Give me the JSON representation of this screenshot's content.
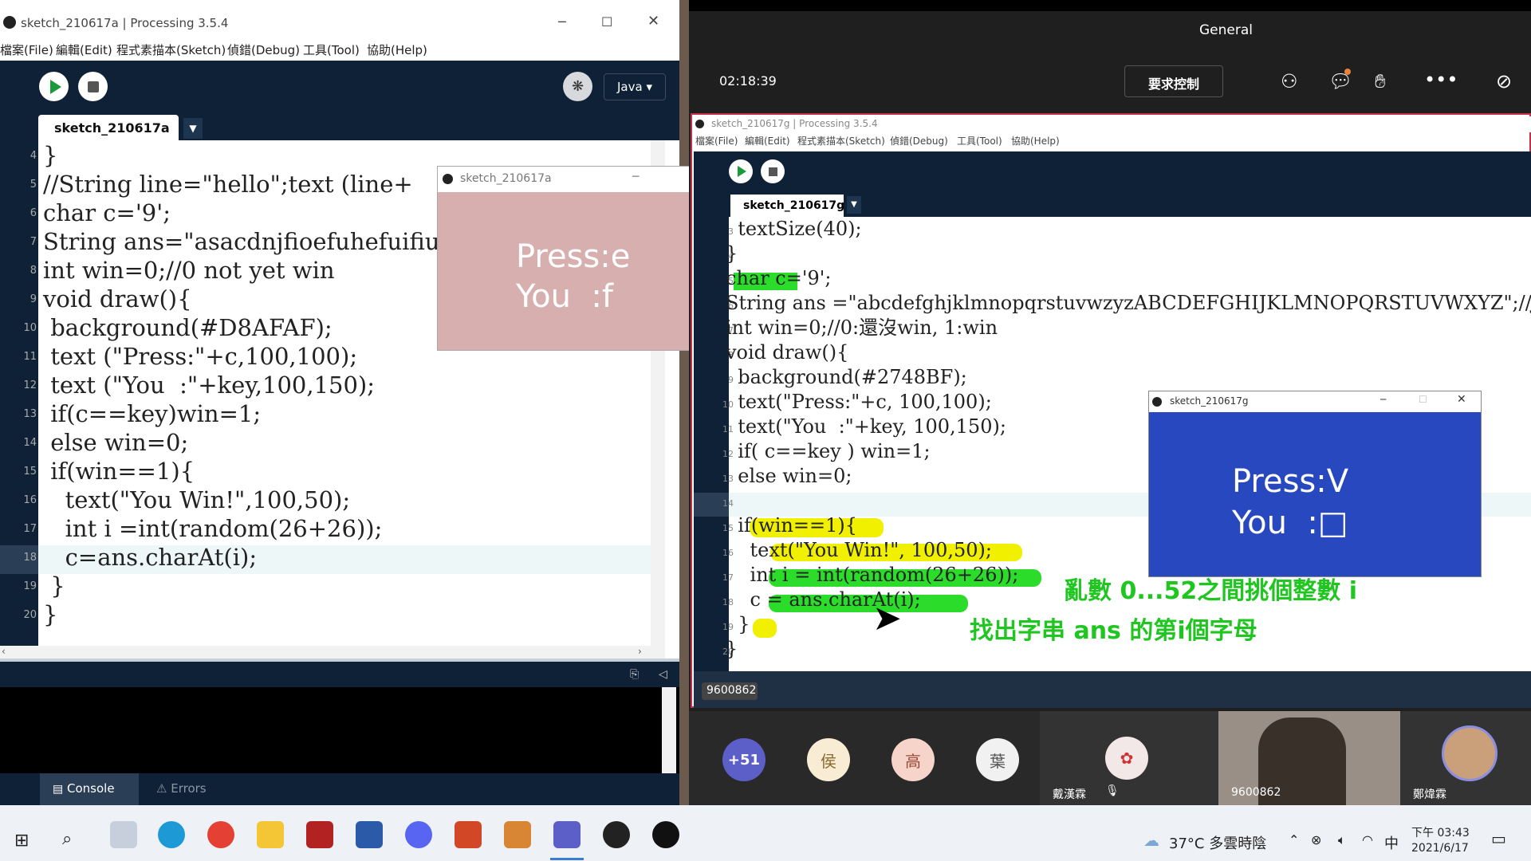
{
  "left": {
    "title": "sketch_210617a | Processing 3.5.4",
    "menu": [
      "檔案(File)",
      "編輯(Edit)",
      "程式素描本(Sketch)",
      "偵錯(Debug)",
      "工具(Tool)",
      "協助(Help)"
    ],
    "mode": "Java",
    "tab": "sketch_210617a",
    "lines": [
      {
        "n": "4",
        "t": "}"
      },
      {
        "n": "5",
        "t": "//String line=\"hello\";text (line+"
      },
      {
        "n": "6",
        "t": "char c='9';"
      },
      {
        "n": "7",
        "t": "String ans=\"asacdnjfioefuhefuifiu"
      },
      {
        "n": "8",
        "t": "int win=0;//0 not yet win"
      },
      {
        "n": "9",
        "t": "void draw(){"
      },
      {
        "n": "10",
        "t": " background(#D8AFAF);"
      },
      {
        "n": "11",
        "t": " text (\"Press:\"+c,100,100);"
      },
      {
        "n": "12",
        "t": " text (\"You  :\"+key,100,150);"
      },
      {
        "n": "13",
        "t": " if(c==key)win=1;"
      },
      {
        "n": "14",
        "t": " else win=0;"
      },
      {
        "n": "15",
        "t": " if(win==1){"
      },
      {
        "n": "16",
        "t": "   text(\"You Win!\",100,50);"
      },
      {
        "n": "17",
        "t": "   int i =int(random(26+26));"
      },
      {
        "n": "18",
        "t": "   c=ans.charAt(i);"
      },
      {
        "n": "19",
        "t": " }"
      },
      {
        "n": "20",
        "t": "}"
      }
    ],
    "console_tab": "Console",
    "errors_tab": "Errors",
    "sketch": {
      "title": "sketch_210617a",
      "press": "Press:e",
      "you": "You  :f",
      "bg": "#D8AFAF"
    }
  },
  "teams": {
    "channel": "General",
    "timer": "02:18:39",
    "request_control": "要求控制",
    "shared": {
      "title": "sketch_210617g | Processing 3.5.4",
      "menu": [
        "檔案(File)",
        "編輯(Edit)",
        "程式素描本(Sketch)",
        "偵錯(Debug)",
        "工具(Tool)",
        "協助(Help)"
      ],
      "tab": "sketch_210617g",
      "lines": [
        {
          "n": "3",
          "t": "  textSize(40);"
        },
        {
          "n": "4",
          "t": "}"
        },
        {
          "n": "5",
          "t": "char c='9';"
        },
        {
          "n": "6",
          "t": "String ans =\"abcdefghjklmnopqrstuvwzyzABCDEFGHIJKLMNOPQRSTUVWXYZ\";//Java的字串"
        },
        {
          "n": "7",
          "t": "int win=0;//0:還沒win, 1:win"
        },
        {
          "n": "8",
          "t": "void draw(){"
        },
        {
          "n": "9",
          "t": "  background(#2748BF);"
        },
        {
          "n": "10",
          "t": "  text(\"Press:\"+c, 100,100);"
        },
        {
          "n": "11",
          "t": "  text(\"You  :\"+key, 100,150);"
        },
        {
          "n": "12",
          "t": "  if( c==key ) win=1;"
        },
        {
          "n": "13",
          "t": "  else win=0;"
        },
        {
          "n": "14",
          "t": ""
        },
        {
          "n": "15",
          "t": "  if(win==1){"
        },
        {
          "n": "16",
          "t": "    text(\"You Win!\", 100,50);"
        },
        {
          "n": "17",
          "t": "    int i = int(random(26+26));"
        },
        {
          "n": "18",
          "t": "    c = ans.charAt(i);"
        },
        {
          "n": "19",
          "t": "  }"
        },
        {
          "n": "20",
          "t": "}"
        }
      ],
      "sketch": {
        "title": "sketch_210617g",
        "press": "Press:V",
        "you": "You  :□",
        "bg": "#2748BF"
      },
      "annot1": "亂數 0...52之間挑個整數 i",
      "annot2": "找出字串 ans 的第i個字母",
      "presenter": "9600862"
    },
    "people": {
      "more": "+51",
      "initials": [
        "侯",
        "高",
        "葉"
      ],
      "p1": "戴漢霖",
      "p2": "9600862",
      "p3": "鄭煒霖"
    }
  },
  "taskbar": {
    "weather": "37°C 多雲時陰",
    "ime": "中",
    "time": "下午 03:43",
    "date": "2021/6/17"
  }
}
